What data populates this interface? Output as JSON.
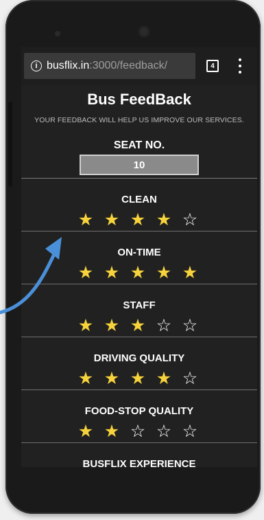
{
  "browser": {
    "url_host": "busflix.in",
    "url_path": ":3000/feedback/",
    "tab_count": "4"
  },
  "page": {
    "title": "Bus FeedBack",
    "subtitle": "YOUR FEEDBACK WILL HELP US IMPROVE OUR SERVICES."
  },
  "seat": {
    "label": "SEAT NO.",
    "value": "10"
  },
  "categories": [
    {
      "label": "CLEAN",
      "rating": 4,
      "max": 5
    },
    {
      "label": "ON-TIME",
      "rating": 5,
      "max": 5
    },
    {
      "label": "STAFF",
      "rating": 3,
      "max": 5
    },
    {
      "label": "DRIVING QUALITY",
      "rating": 4,
      "max": 5
    },
    {
      "label": "FOOD-STOP QUALITY",
      "rating": 2,
      "max": 5
    }
  ],
  "partial_section_label": "BUSFLIX EXPERIENCE",
  "colors": {
    "star_filled": "#f7d33b",
    "star_empty": "#ffffff",
    "arrow": "#4a90d9",
    "screen_bg": "#212121"
  }
}
